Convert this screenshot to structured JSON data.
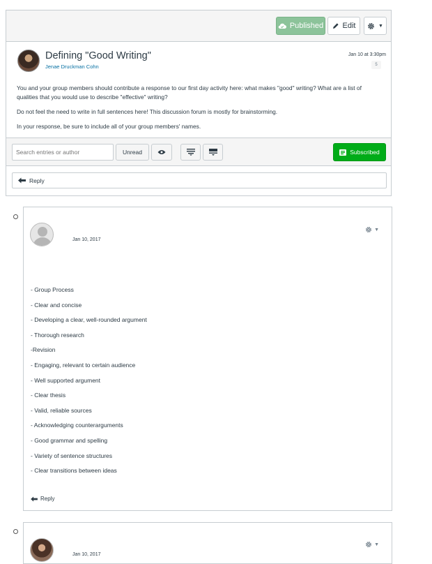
{
  "toolbar": {
    "published_label": "Published",
    "edit_label": "Edit"
  },
  "topic": {
    "title": "Defining \"Good Writing\"",
    "author": "Jenae Druckman Cohn",
    "date": "Jan 10 at 3:30pm",
    "badge": "5",
    "paragraphs": [
      "You and your group members should contribute a response to our first day activity here: what makes \"good\" writing? What are a list of qualities that you would use to describe \"effective\" writing?",
      "Do not feel the need to write in full sentences here! This discussion forum is mostly for brainstorming.",
      "In your response, be sure to include all of your group members' names."
    ]
  },
  "controls": {
    "search_placeholder": "Search entries or author",
    "unread_label": "Unread",
    "subscribed_label": "Subscribed"
  },
  "reply_label": "Reply",
  "entries": [
    {
      "date": "Jan 10, 2017",
      "lines": [
        "- Group Process",
        "- Clear and concise",
        "- Developing a clear, well-rounded argument",
        "- Thorough research",
        "-Revision",
        "- Engaging, relevant to certain audience",
        "- Well supported argument",
        "- Clear thesis",
        "- Valid, reliable sources",
        "- Acknowledging counterarguments",
        "- Good grammar and spelling",
        "- Variety of sentence structures",
        "- Clear transitions between ideas"
      ],
      "reply_label": "Reply"
    },
    {
      "date": "Jan 10, 2017"
    }
  ],
  "colors": {
    "published": "#8cc39a",
    "subscribed": "#00ac18",
    "link": "#0770a3"
  },
  "icons": [
    "cloud-check-icon",
    "pencil-icon",
    "gear-icon",
    "eye-icon",
    "collapse-icon",
    "expand-icon",
    "subscribe-icon",
    "reply-arrow-icon"
  ]
}
